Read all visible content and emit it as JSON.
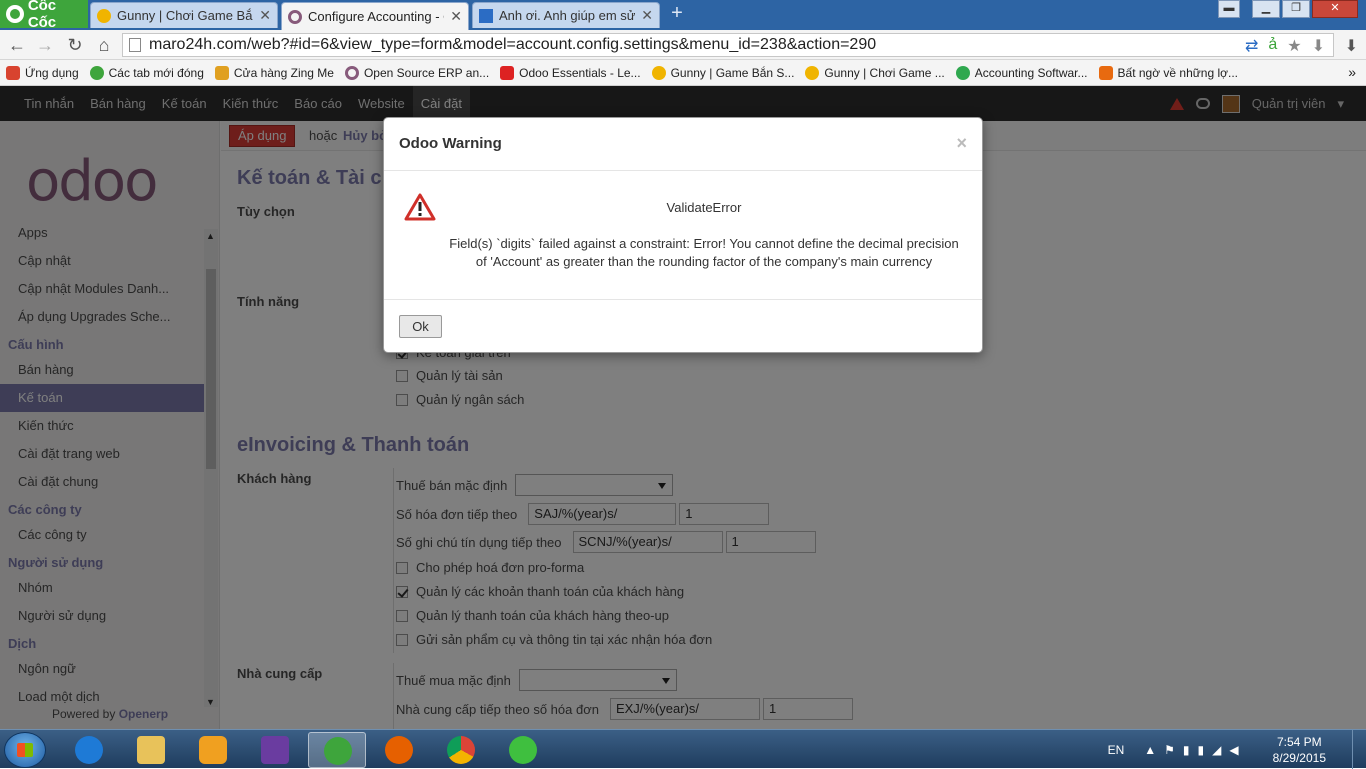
{
  "browser": {
    "brand": "Cốc Cốc",
    "tabs": [
      {
        "label": "Gunny | Chơi Game Bắn Sú",
        "active": false
      },
      {
        "label": "Configure Accounting - Oc",
        "active": true
      },
      {
        "label": "Anh ơi. Anh giúp em sửa c",
        "active": false
      }
    ],
    "url": "maro24h.com/web?#id=6&view_type=form&model=account.config.settings&menu_id=238&action=290",
    "bookmarks": [
      "Ứng dụng",
      "Các tab mới đóng",
      "Cửa hàng Zing Me",
      "Open Source ERP an...",
      "Odoo Essentials - Le...",
      "Gunny | Game Bắn S...",
      "Gunny | Chơi Game ...",
      "Accounting Softwar...",
      "Bất ngờ về những lợ..."
    ],
    "bookmark_colors": [
      "#d8432f",
      "#3ea53c",
      "#e0a020",
      "#875a7b",
      "#d22",
      "#f0b400",
      "#f0b400",
      "#2fa84f",
      "#e86a10"
    ]
  },
  "odoo_nav": {
    "items": [
      "Tin nhắn",
      "Bán hàng",
      "Kế toán",
      "Kiến thức",
      "Báo cáo",
      "Website",
      "Cài đặt"
    ],
    "active_index": 6,
    "user": "Quản trị viên"
  },
  "sidebar": {
    "logo": "odoo",
    "sections": [
      {
        "head": null,
        "items": [
          "Apps",
          "Cập nhật",
          "Cập nhật Modules Danh...",
          "Áp dụng Upgrades Sche..."
        ]
      },
      {
        "head": "Cấu hình",
        "items": [
          "Bán hàng",
          "Kế toán",
          "Kiến thức",
          "Cài đặt trang web",
          "Cài đặt chung"
        ]
      },
      {
        "head": "Các công ty",
        "items": [
          "Các công ty"
        ]
      },
      {
        "head": "Người sử dụng",
        "items": [
          "Nhóm",
          "Người sử dụng"
        ]
      },
      {
        "head": "Dịch",
        "items": [
          "Ngôn ngữ",
          "Load một dịch"
        ]
      }
    ],
    "active_item": "Kế toán",
    "powered_by": "Powered by",
    "powered_brand": "Openerp"
  },
  "control_panel": {
    "apply": "Áp dụng",
    "or": "hoặc",
    "cancel": "Hủy bỏ"
  },
  "form": {
    "title": "Kế toán & Tài c",
    "options_label": "Tùy chọn",
    "features_label": "Tính năng",
    "features": [
      {
        "label": "Kế toán giải trên",
        "checked": true
      },
      {
        "label": "Quản lý tài sản",
        "checked": false
      },
      {
        "label": "Quản lý ngân sách",
        "checked": false
      }
    ],
    "einvoicing_title": "eInvoicing & Thanh toán",
    "customer_label": "Khách hàng",
    "customer": {
      "sale_tax_label": "Thuế bán mặc định",
      "sale_tax_value": "",
      "next_invoice_label": "Số hóa đơn tiếp theo",
      "next_invoice_prefix": "SAJ/%(year)s/",
      "next_invoice_number": "1",
      "next_credit_label": "Số ghi chú tín dụng tiếp theo",
      "next_credit_prefix": "SCNJ/%(year)s/",
      "next_credit_number": "1",
      "checks": [
        {
          "label": "Cho phép hoá đơn pro-forma",
          "checked": false
        },
        {
          "label": "Quản lý các khoản thanh toán của khách hàng",
          "checked": true
        },
        {
          "label": "Quản lý thanh toán của khách hàng theo-up",
          "checked": false
        },
        {
          "label": "Gửi sản phẩm cụ và thông tin tại xác nhận hóa đơn",
          "checked": false
        }
      ]
    },
    "supplier_label": "Nhà cung cấp",
    "supplier": {
      "purchase_tax_label": "Thuế mua mặc định",
      "purchase_tax_value": "",
      "next_invoice_label": "Nhà cung cấp tiếp theo số hóa đơn",
      "next_invoice_prefix": "EXJ/%(year)s/",
      "next_invoice_number": "1"
    }
  },
  "dialog": {
    "title": "Odoo Warning",
    "close": "×",
    "error_title": "ValidateError",
    "message_line1": "Field(s) `digits` failed against a constraint: Error! You cannot define the decimal precision",
    "message_line2": "of 'Account' as greater than the rounding factor of the company's main currency",
    "ok": "Ok"
  },
  "taskbar": {
    "language": "EN",
    "time": "7:54 PM",
    "date": "8/29/2015",
    "apps": [
      "internet-explorer",
      "file-explorer",
      "media-player",
      "visual-studio",
      "coc-coc",
      "firefox",
      "chrome",
      "dreamweaver"
    ],
    "app_colors": [
      "#1e7ad6",
      "#e8c25a",
      "#f0a020",
      "#6a3ca0",
      "#3ea53c",
      "#e66000",
      "#2fa84f",
      "#3fbf3f"
    ]
  }
}
